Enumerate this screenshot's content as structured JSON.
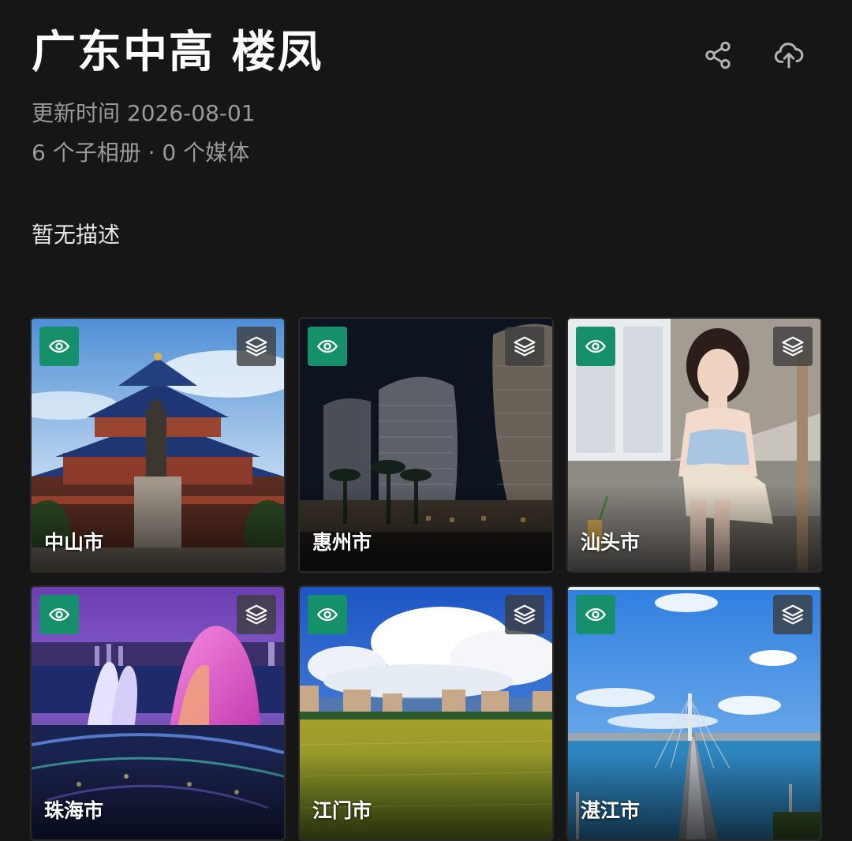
{
  "album": {
    "title": "广东中高 楼凤",
    "updated": "更新时间 2026-08-01",
    "counts": "6 个子相册 · 0 个媒体",
    "description": "暂无描述"
  },
  "actions": {
    "share_icon": "share-icon",
    "upload_icon": "cloud-upload-icon"
  },
  "colors": {
    "background": "#161616",
    "view_badge": "#16906a",
    "meta_text": "#9a9a9a"
  },
  "sub_albums": [
    {
      "label": "中山市",
      "view_icon": "eye-icon",
      "stack_icon": "layers-icon",
      "image": "Sun Yat-sen Memorial Hall with statue"
    },
    {
      "label": "惠州市",
      "view_icon": "eye-icon",
      "stack_icon": "layers-icon",
      "image": "modern towers at night with palm trees"
    },
    {
      "label": "汕头市",
      "view_icon": "eye-icon",
      "stack_icon": "layers-icon",
      "image": "woman sitting on steps by window"
    },
    {
      "label": "珠海市",
      "view_icon": "eye-icon",
      "stack_icon": "layers-icon",
      "image": "illuminated shell-shaped opera house at dusk"
    },
    {
      "label": "江门市",
      "view_icon": "eye-icon",
      "stack_icon": "layers-icon",
      "image": "rice field with diaolou towers under clouds"
    },
    {
      "label": "湛江市",
      "view_icon": "eye-icon",
      "stack_icon": "layers-icon",
      "image": "cable-stayed bridge over bay"
    }
  ]
}
